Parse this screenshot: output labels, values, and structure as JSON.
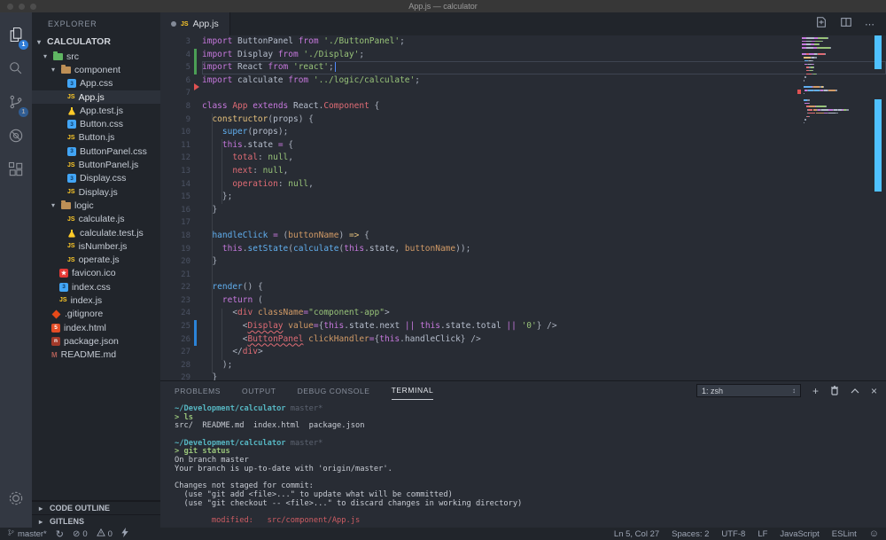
{
  "window": {
    "title": "App.js — calculator",
    "controls": [
      "close",
      "minimize",
      "zoom"
    ]
  },
  "activity_bar": {
    "items": [
      {
        "name": "explorer",
        "icon": "files-icon",
        "badge": "1",
        "active": true
      },
      {
        "name": "search",
        "icon": "search-icon"
      },
      {
        "name": "source-control",
        "icon": "git-branch-icon",
        "badge": "1"
      },
      {
        "name": "debug",
        "icon": "debug-icon"
      },
      {
        "name": "extensions",
        "icon": "extensions-icon"
      }
    ],
    "bottom": [
      {
        "name": "settings",
        "icon": "gear-icon"
      }
    ]
  },
  "sidebar": {
    "title": "EXPLORER",
    "root_label": "CALCULATOR",
    "tree": [
      {
        "label": "src",
        "type": "folder",
        "icon": "folder-src",
        "level": 1,
        "expanded": true
      },
      {
        "label": "component",
        "type": "folder",
        "icon": "folder",
        "level": 2,
        "expanded": true
      },
      {
        "label": "App.css",
        "type": "file",
        "icon": "css",
        "level": 3
      },
      {
        "label": "App.js",
        "type": "file",
        "icon": "js",
        "level": 3,
        "selected": true
      },
      {
        "label": "App.test.js",
        "type": "file",
        "icon": "test",
        "level": 3
      },
      {
        "label": "Button.css",
        "type": "file",
        "icon": "css",
        "level": 3
      },
      {
        "label": "Button.js",
        "type": "file",
        "icon": "js",
        "level": 3
      },
      {
        "label": "ButtonPanel.css",
        "type": "file",
        "icon": "css",
        "level": 3
      },
      {
        "label": "ButtonPanel.js",
        "type": "file",
        "icon": "js",
        "level": 3
      },
      {
        "label": "Display.css",
        "type": "file",
        "icon": "css",
        "level": 3
      },
      {
        "label": "Display.js",
        "type": "file",
        "icon": "js",
        "level": 3
      },
      {
        "label": "logic",
        "type": "folder",
        "icon": "folder",
        "level": 2,
        "expanded": true
      },
      {
        "label": "calculate.js",
        "type": "file",
        "icon": "js",
        "level": 3
      },
      {
        "label": "calculate.test.js",
        "type": "file",
        "icon": "test",
        "level": 3
      },
      {
        "label": "isNumber.js",
        "type": "file",
        "icon": "js",
        "level": 3
      },
      {
        "label": "operate.js",
        "type": "file",
        "icon": "js",
        "level": 3
      },
      {
        "label": "favicon.ico",
        "type": "file",
        "icon": "ico",
        "level": 2
      },
      {
        "label": "index.css",
        "type": "file",
        "icon": "css",
        "level": 2
      },
      {
        "label": "index.js",
        "type": "file",
        "icon": "js",
        "level": 2
      },
      {
        "label": ".gitignore",
        "type": "file",
        "icon": "git",
        "level": 1
      },
      {
        "label": "index.html",
        "type": "file",
        "icon": "html",
        "level": 1
      },
      {
        "label": "package.json",
        "type": "file",
        "icon": "json",
        "level": 1
      },
      {
        "label": "README.md",
        "type": "file",
        "icon": "md",
        "level": 1
      }
    ],
    "sections": [
      {
        "label": "CODE OUTLINE"
      },
      {
        "label": "GITLENS"
      }
    ]
  },
  "editor": {
    "tab": {
      "label": "App.js",
      "dirty": true
    },
    "actions": [
      {
        "name": "open-changes"
      },
      {
        "name": "split-editor"
      },
      {
        "name": "more-actions"
      }
    ],
    "current_line": 5,
    "cursor": {
      "line": 5,
      "col": 27
    },
    "gutter": {
      "4": "added",
      "5": "added",
      "7": "deleted",
      "25": "modified",
      "26": "modified"
    },
    "lines": [
      {
        "n": 3,
        "tokens": [
          [
            "kw",
            "import "
          ],
          [
            "id",
            "ButtonPanel "
          ],
          [
            "kw",
            "from "
          ],
          [
            "str",
            "'./ButtonPanel'"
          ],
          [
            "punct",
            ";"
          ]
        ]
      },
      {
        "n": 4,
        "tokens": [
          [
            "kw",
            "import "
          ],
          [
            "id",
            "Display "
          ],
          [
            "kw",
            "from "
          ],
          [
            "str",
            "'./Display'"
          ],
          [
            "punct",
            ";"
          ]
        ]
      },
      {
        "n": 5,
        "tokens": [
          [
            "kw",
            "import "
          ],
          [
            "id",
            "React "
          ],
          [
            "kw",
            "from "
          ],
          [
            "str",
            "'react'"
          ],
          [
            "punct",
            ";"
          ]
        ]
      },
      {
        "n": 6,
        "tokens": [
          [
            "kw",
            "import "
          ],
          [
            "id",
            "calculate "
          ],
          [
            "kw",
            "from "
          ],
          [
            "str",
            "'../logic/calculate'"
          ],
          [
            "punct",
            ";"
          ]
        ]
      },
      {
        "n": 7,
        "tokens": []
      },
      {
        "n": 8,
        "tokens": [
          [
            "kw",
            "class "
          ],
          [
            "cls",
            "App "
          ],
          [
            "kw",
            "extends "
          ],
          [
            "id",
            "React"
          ],
          [
            "punct",
            "."
          ],
          [
            "cls",
            "Component "
          ],
          [
            "punct",
            "{"
          ]
        ]
      },
      {
        "n": 9,
        "tokens": [
          [
            "punct",
            "  "
          ],
          [
            "yel",
            "constructor"
          ],
          [
            "punct",
            "("
          ],
          [
            "id",
            "props"
          ],
          [
            "punct",
            ") {"
          ]
        ]
      },
      {
        "n": 10,
        "tokens": [
          [
            "punct",
            "    "
          ],
          [
            "fn",
            "super"
          ],
          [
            "punct",
            "("
          ],
          [
            "id",
            "props"
          ],
          [
            "punct",
            ");"
          ]
        ]
      },
      {
        "n": 11,
        "tokens": [
          [
            "punct",
            "    "
          ],
          [
            "kw",
            "this"
          ],
          [
            "punct",
            "."
          ],
          [
            "id",
            "state "
          ],
          [
            "op",
            "= "
          ],
          [
            "punct",
            "{"
          ]
        ]
      },
      {
        "n": 12,
        "tokens": [
          [
            "punct",
            "      "
          ],
          [
            "prop",
            "total"
          ],
          [
            "punct",
            ": "
          ],
          [
            "val",
            "null"
          ],
          [
            "punct",
            ","
          ]
        ]
      },
      {
        "n": 13,
        "tokens": [
          [
            "punct",
            "      "
          ],
          [
            "prop",
            "next"
          ],
          [
            "punct",
            ": "
          ],
          [
            "val",
            "null"
          ],
          [
            "punct",
            ","
          ]
        ]
      },
      {
        "n": 14,
        "tokens": [
          [
            "punct",
            "      "
          ],
          [
            "prop",
            "operation"
          ],
          [
            "punct",
            ": "
          ],
          [
            "val",
            "null"
          ],
          [
            "punct",
            ","
          ]
        ]
      },
      {
        "n": 15,
        "tokens": [
          [
            "punct",
            "    };"
          ]
        ]
      },
      {
        "n": 16,
        "tokens": [
          [
            "punct",
            "  }"
          ]
        ]
      },
      {
        "n": 17,
        "tokens": []
      },
      {
        "n": 18,
        "tokens": [
          [
            "punct",
            "  "
          ],
          [
            "fn",
            "handleClick "
          ],
          [
            "op",
            "= "
          ],
          [
            "punct",
            "("
          ],
          [
            "param",
            "buttonName"
          ],
          [
            "punct",
            ") "
          ],
          [
            "yel",
            "=> "
          ],
          [
            "punct",
            "{"
          ]
        ]
      },
      {
        "n": 19,
        "tokens": [
          [
            "punct",
            "    "
          ],
          [
            "kw",
            "this"
          ],
          [
            "punct",
            "."
          ],
          [
            "fn",
            "setState"
          ],
          [
            "punct",
            "("
          ],
          [
            "fn",
            "calculate"
          ],
          [
            "punct",
            "("
          ],
          [
            "kw",
            "this"
          ],
          [
            "punct",
            "."
          ],
          [
            "id",
            "state"
          ],
          [
            "punct",
            ", "
          ],
          [
            "param",
            "buttonName"
          ],
          [
            "punct",
            "));"
          ]
        ]
      },
      {
        "n": 20,
        "tokens": [
          [
            "punct",
            "  }"
          ]
        ]
      },
      {
        "n": 21,
        "tokens": []
      },
      {
        "n": 22,
        "tokens": [
          [
            "punct",
            "  "
          ],
          [
            "fn",
            "render"
          ],
          [
            "punct",
            "() {"
          ]
        ]
      },
      {
        "n": 23,
        "tokens": [
          [
            "punct",
            "    "
          ],
          [
            "kw",
            "return "
          ],
          [
            "punct",
            "("
          ]
        ]
      },
      {
        "n": 24,
        "tokens": [
          [
            "punct",
            "      <"
          ],
          [
            "cls",
            "div "
          ],
          [
            "attr",
            "className"
          ],
          [
            "op",
            "="
          ],
          [
            "str",
            "\"component-app\""
          ],
          [
            "punct",
            ">"
          ]
        ]
      },
      {
        "n": 25,
        "tokens": [
          [
            "punct",
            "        <"
          ],
          [
            "tagerr",
            "Display"
          ],
          [
            "punct",
            " "
          ],
          [
            "attr",
            "value"
          ],
          [
            "op",
            "="
          ],
          [
            "punct",
            "{"
          ],
          [
            "kw",
            "this"
          ],
          [
            "punct",
            "."
          ],
          [
            "id",
            "state"
          ],
          [
            "punct",
            "."
          ],
          [
            "id",
            "next "
          ],
          [
            "op",
            "|| "
          ],
          [
            "kw",
            "this"
          ],
          [
            "punct",
            "."
          ],
          [
            "id",
            "state"
          ],
          [
            "punct",
            "."
          ],
          [
            "id",
            "total "
          ],
          [
            "op",
            "|| "
          ],
          [
            "str",
            "'0'"
          ],
          [
            "punct",
            "} />"
          ]
        ]
      },
      {
        "n": 26,
        "tokens": [
          [
            "punct",
            "        <"
          ],
          [
            "tagerr",
            "ButtonPanel"
          ],
          [
            "punct",
            " "
          ],
          [
            "attr",
            "clickHandler"
          ],
          [
            "op",
            "="
          ],
          [
            "punct",
            "{"
          ],
          [
            "kw",
            "this"
          ],
          [
            "punct",
            "."
          ],
          [
            "id",
            "handleClick"
          ],
          [
            "punct",
            "} />"
          ]
        ]
      },
      {
        "n": 27,
        "tokens": [
          [
            "punct",
            "      </"
          ],
          [
            "cls",
            "div"
          ],
          [
            "punct",
            ">"
          ]
        ]
      },
      {
        "n": 28,
        "tokens": [
          [
            "punct",
            "    );"
          ]
        ]
      },
      {
        "n": 29,
        "tokens": [
          [
            "punct",
            "  }"
          ]
        ]
      }
    ]
  },
  "panel": {
    "tabs": [
      {
        "label": "PROBLEMS"
      },
      {
        "label": "OUTPUT"
      },
      {
        "label": "DEBUG CONSOLE"
      },
      {
        "label": "TERMINAL",
        "active": true
      }
    ],
    "shell_select": "1: zsh",
    "actions": [
      {
        "name": "new-terminal"
      },
      {
        "name": "kill-terminal"
      },
      {
        "name": "maximize-panel"
      },
      {
        "name": "close-panel"
      }
    ],
    "terminal_lines": [
      {
        "tokens": [
          [
            "cyan",
            "~/Development/calculator"
          ],
          [
            "dim",
            " master*"
          ]
        ]
      },
      {
        "tokens": [
          [
            "green",
            "> "
          ],
          [
            "green",
            "ls"
          ]
        ]
      },
      {
        "tokens": [
          [
            "plain",
            "src/  README.md  index.html  package.json"
          ]
        ]
      },
      {
        "tokens": []
      },
      {
        "tokens": [
          [
            "cyan",
            "~/Development/calculator"
          ],
          [
            "dim",
            " master*"
          ]
        ]
      },
      {
        "tokens": [
          [
            "green",
            "> "
          ],
          [
            "green",
            "git status"
          ]
        ]
      },
      {
        "tokens": [
          [
            "plain",
            "On branch master"
          ]
        ]
      },
      {
        "tokens": [
          [
            "plain",
            "Your branch is up-to-date with 'origin/master'."
          ]
        ]
      },
      {
        "tokens": []
      },
      {
        "tokens": [
          [
            "plain",
            "Changes not staged for commit:"
          ]
        ]
      },
      {
        "tokens": [
          [
            "plain",
            "  (use \"git add <file>...\" to update what will be committed)"
          ]
        ]
      },
      {
        "tokens": [
          [
            "plain",
            "  (use \"git checkout -- <file>...\" to discard changes in working directory)"
          ]
        ]
      },
      {
        "tokens": []
      },
      {
        "tokens": [
          [
            "red",
            "        modified:   src/component/App.js"
          ]
        ]
      }
    ]
  },
  "status_bar": {
    "branch": "master*",
    "errors": "0",
    "warnings": "0",
    "right_items": [
      "Ln 5, Col 27",
      "Spaces: 2",
      "UTF-8",
      "LF",
      "JavaScript",
      "ESLint"
    ]
  },
  "colors": {
    "badge_blue": "#2f7cd6",
    "overview_modified_blue": "#4fc1ff",
    "git_added_green": "#4b9e55",
    "git_modified_blue": "#2b83d8",
    "git_deleted_red": "#e05252",
    "keyword_magenta": "#c678dd",
    "string_green": "#98c379",
    "tag_error_red": "#e06c75"
  }
}
